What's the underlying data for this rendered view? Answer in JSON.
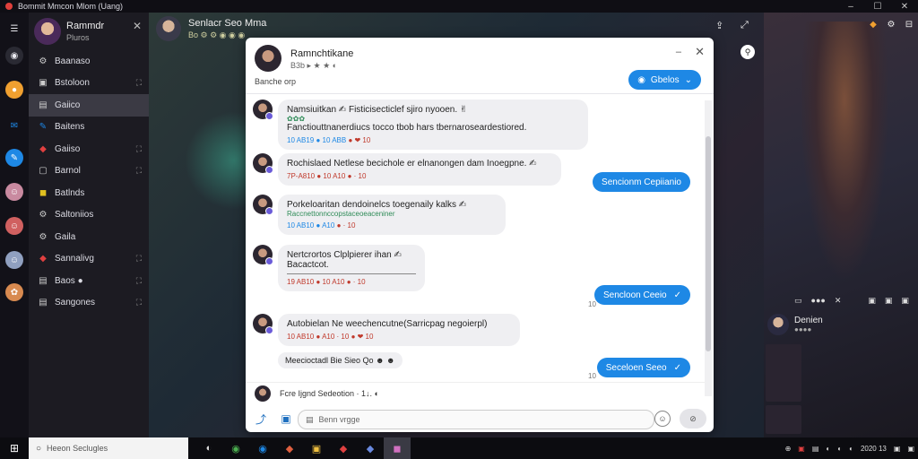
{
  "window": {
    "title": "Bommit Mmcon Mlom (Uang)",
    "controls": [
      "–",
      "☐",
      "✕"
    ]
  },
  "rail": {
    "items": [
      {
        "icon": "menu-icon",
        "glyph": "☰",
        "color": "#dddddd"
      },
      {
        "icon": "globe-icon",
        "glyph": "◉",
        "color": "#bbbbbb"
      },
      {
        "icon": "coin-icon",
        "glyph": "●",
        "color": "#f0a030"
      },
      {
        "icon": "mail-icon",
        "glyph": "✉",
        "color": "#1e88e5"
      },
      {
        "icon": "chat-icon",
        "glyph": "✎",
        "color": "#1e88e5"
      },
      {
        "icon": "avatar-icon",
        "glyph": "☺",
        "color": "#c98aa0"
      },
      {
        "icon": "avatar-icon",
        "glyph": "☺",
        "color": "#d06060"
      },
      {
        "icon": "avatar-icon",
        "glyph": "☺",
        "color": "#90a0c0"
      },
      {
        "icon": "gear-icon",
        "glyph": "✿",
        "color": "#d88a50"
      }
    ]
  },
  "sidebar": {
    "user": {
      "name": "Rammdr",
      "status": "Pluros"
    },
    "items": [
      {
        "label": "Baanaso",
        "icon": "⚙",
        "extra": ""
      },
      {
        "label": "Bstoloon",
        "icon": "▣",
        "extra": "⛶"
      },
      {
        "label": "Gaiico",
        "icon": "▤",
        "extra": ""
      },
      {
        "label": "Baitens",
        "icon": "✎",
        "extra": ""
      },
      {
        "label": "Gaiiso",
        "icon": "◆",
        "extra": "⛶"
      },
      {
        "label": "Barnol",
        "icon": "▢",
        "extra": "⛶"
      },
      {
        "label": "Batlnds",
        "icon": "◼",
        "extra": ""
      },
      {
        "label": "Saltoniios",
        "icon": "⚙",
        "extra": ""
      },
      {
        "label": "Gaila",
        "icon": "⚙",
        "extra": ""
      },
      {
        "label": "Sannalivg",
        "icon": "◆",
        "extra": "⛶"
      },
      {
        "label": "Baos ●",
        "icon": "▤",
        "extra": "⛶"
      },
      {
        "label": "Sangones",
        "icon": "▤",
        "extra": "⛶"
      }
    ],
    "selected_index": 2
  },
  "stream": {
    "name": "Senlacr Seo Mma",
    "sub": "Bo ⚙ ⚙ ◉ ◉ ◉",
    "actions": [
      "⇪",
      "⤢"
    ]
  },
  "chat": {
    "name": "Ramnchtikane",
    "status": "B3b ▸ ★ ★  ◐",
    "subtitle": "Banche orp",
    "minimize": "–",
    "close": "✕",
    "pill": "Gbelos",
    "messages_in": [
      {
        "text": "Namsiuitkan ✍ Fisticisecticlef sjiro nyooen. ✌",
        "line2": "Fanctiouttnanerdiucs tocco tbob hars tbernaroseardestiored.",
        "green": "✿✿✿",
        "meta_a": "10 AB19 ● 10 ABB",
        "meta_b": "● ❤ 10"
      },
      {
        "text": "Rochislaed Netlese becichole er elnanongen dam Inoegpne. ✍",
        "meta_a": "7P-A810 ● 10 A10",
        "meta_b": "● · 10"
      },
      {
        "text": "Porkeloaritan dendoinelcs toegenaily kalks ✍",
        "line2": "Raccnettonnccopstaceoeaceniner",
        "meta_a": "10 AB10 ● A10",
        "meta_b": "● · 10"
      },
      {
        "text": "Nertcrortos Clplpierer ihan ✍",
        "line2": "Bacactcot.",
        "meta_a": "19 AB10 ● 10 A10",
        "meta_b": "● · 10"
      },
      {
        "text": "Autobielan Ne weechencutne​(Sarricpag negoierpl)",
        "meta_a": "10 AB10 ● A10 · 10",
        "meta_b": "● ❤ 10"
      },
      {
        "text": "Meecioctadl Bie Sieo  Qo ☻ ☻"
      }
    ],
    "messages_out": [
      {
        "text": "Sencionm Cepiianio",
        "check": ""
      },
      {
        "text": "Sencloon Ceeio",
        "check": "✓",
        "read": "10"
      },
      {
        "text": "Seceloen Seeo",
        "check": "✓",
        "read": "10"
      }
    ],
    "typing": "Fcre Ijgnd Sedeotion · 1↓. ◐",
    "compose": {
      "placeholder": "Benn vrgge",
      "send": "⊘"
    }
  },
  "right_panel": {
    "controls": [
      "◆",
      "⚙",
      "⊟"
    ],
    "bar": [
      "▭",
      "●●●",
      "✕",
      "▣",
      "▣",
      "▣"
    ],
    "streamer": {
      "name": "Denien",
      "status": "●●●●"
    }
  },
  "taskbar": {
    "start": "⊞",
    "search_placeholder": "Heeon Seclugles",
    "apps": [
      "◐",
      "◉",
      "◉",
      "◆",
      "▣",
      "◆",
      "◆",
      "◼"
    ],
    "tray": [
      "⊕",
      "▣",
      "▤",
      "◐",
      "◐",
      "◐",
      "2020 13",
      "▣",
      "▣"
    ]
  }
}
